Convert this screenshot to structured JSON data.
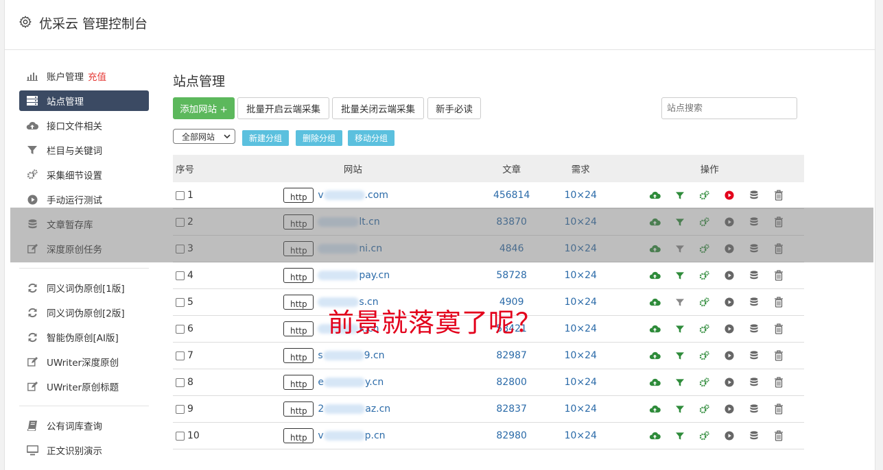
{
  "header": {
    "title": "优采云 管理控制台"
  },
  "sidebar": {
    "items": [
      {
        "label": "账户管理",
        "extra": "充值",
        "icon": "bar-chart-icon"
      },
      {
        "label": "站点管理",
        "icon": "server-icon",
        "active": true
      },
      {
        "label": "接口文件相关",
        "icon": "cloud-upload-icon"
      },
      {
        "label": "栏目与关键词",
        "icon": "filter-icon"
      },
      {
        "label": "采集细节设置",
        "icon": "gears-icon"
      },
      {
        "label": "手动运行测试",
        "icon": "play-circle-icon"
      },
      {
        "label": "文章暂存库",
        "icon": "database-icon"
      },
      {
        "label": "深度原创任务",
        "icon": "edit-icon"
      },
      {
        "label": "同义词伪原创[1版]",
        "icon": "refresh-icon"
      },
      {
        "label": "同义词伪原创[2版]",
        "icon": "refresh-icon"
      },
      {
        "label": "智能伪原创[AI版]",
        "icon": "refresh-icon"
      },
      {
        "label": "UWriter深度原创",
        "icon": "edit-icon"
      },
      {
        "label": "UWriter原创标题",
        "icon": "edit-icon"
      },
      {
        "label": "公有词库查询",
        "icon": "book-icon"
      },
      {
        "label": "正文识别演示",
        "icon": "monitor-icon"
      }
    ]
  },
  "main": {
    "title": "站点管理",
    "buttons": {
      "add_site": "添加网站 +",
      "batch_open": "批量开启云端采集",
      "batch_close": "批量关闭云端采集",
      "newbie": "新手必读"
    },
    "search_placeholder": "站点搜索",
    "group_select": "全部网站",
    "group_buttons": {
      "new": "新建分组",
      "delete": "删除分组",
      "move": "移动分组"
    },
    "table": {
      "headers": {
        "no": "序号",
        "site": "网站",
        "articles": "文章",
        "demand": "需求",
        "ops": "操作"
      },
      "http_label": "http",
      "rows": [
        {
          "no": "1",
          "site": "v",
          "site_tail": ".com",
          "articles": "456814",
          "demand": "10×24"
        },
        {
          "no": "2",
          "site": "",
          "site_tail": "lt.cn",
          "articles": "83870",
          "demand": "10×24"
        },
        {
          "no": "3",
          "site": "",
          "site_tail": "ni.cn",
          "articles": "4846",
          "demand": "10×24"
        },
        {
          "no": "4",
          "site": "",
          "site_tail": "pay.cn",
          "articles": "58728",
          "demand": "10×24"
        },
        {
          "no": "5",
          "site": "",
          "site_tail": "s.cn",
          "articles": "4909",
          "demand": "10×24"
        },
        {
          "no": "6",
          "site": "",
          "site_tail": "k.cn",
          "articles": "58421",
          "demand": "10×24"
        },
        {
          "no": "7",
          "site": "s",
          "site_tail": "9.cn",
          "articles": "82987",
          "demand": "10×24"
        },
        {
          "no": "8",
          "site": "e",
          "site_tail": "y.cn",
          "articles": "82800",
          "demand": "10×24"
        },
        {
          "no": "9",
          "site": "2",
          "site_tail": "az.cn",
          "articles": "82837",
          "demand": "10×24"
        },
        {
          "no": "10",
          "site": "v",
          "site_tail": "p.cn",
          "articles": "82980",
          "demand": "10×24"
        }
      ]
    }
  },
  "overlay_text": "前景就落寞了呢？",
  "colors": {
    "green": "#5cb85c",
    "info": "#5bc0de",
    "active_nav": "#3b4a63",
    "link": "#2a6aa8",
    "red": "#e53935"
  }
}
